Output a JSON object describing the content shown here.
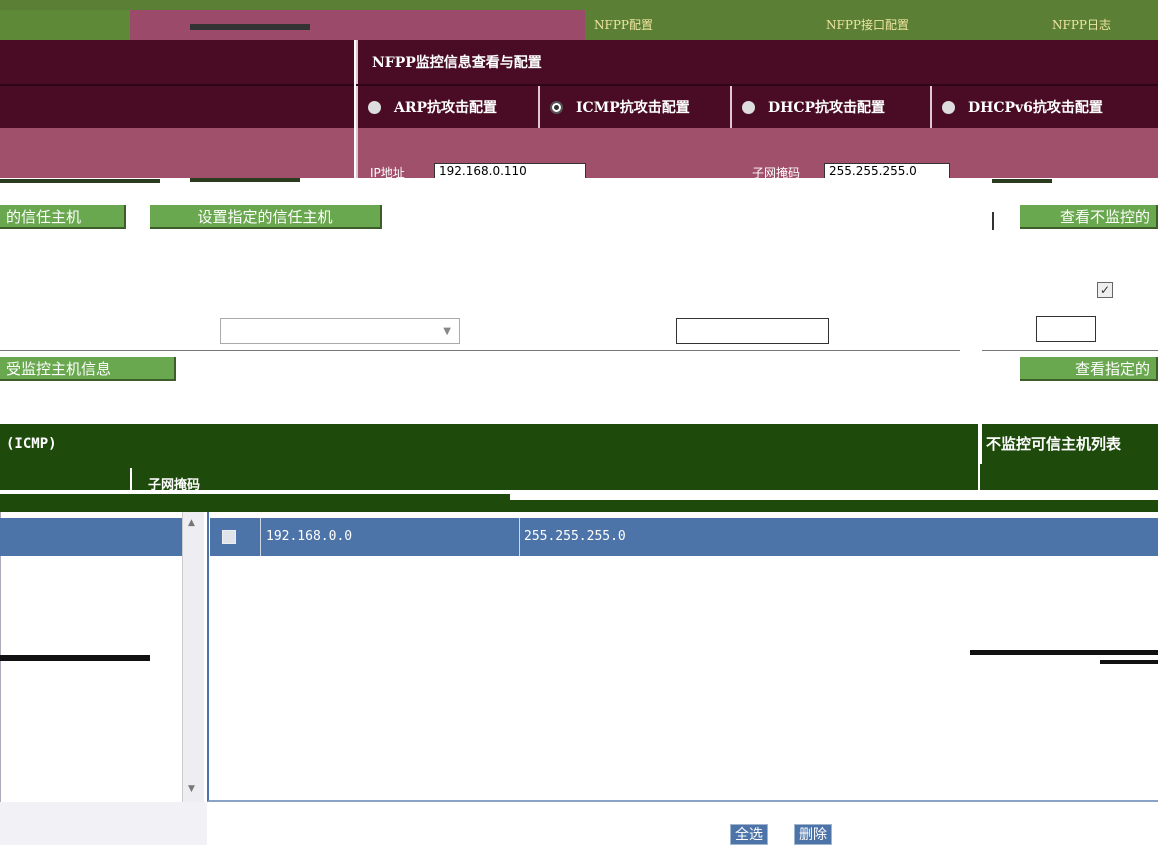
{
  "tabs": [
    {
      "label": "NFPP配置"
    },
    {
      "label": "NFPP接口配置"
    },
    {
      "label": "NFPP日志"
    }
  ],
  "panel": {
    "title": "NFPP监控信息查看与配置",
    "radios": [
      {
        "label": "ARP抗攻击配置",
        "selected": false
      },
      {
        "label": "ICMP抗攻击配置",
        "selected": true
      },
      {
        "label": "DHCP抗攻击配置",
        "selected": false
      },
      {
        "label": "DHCPv6抗攻击配置",
        "selected": false
      }
    ],
    "ip_label": "IP地址",
    "ip_value": "192.168.0.110",
    "mask_label": "子网掩码",
    "mask_value": "255.255.255.0"
  },
  "buttons": {
    "trusted_host": "的信任主机",
    "set_trusted_host": "设置指定的信任主机",
    "view_unmonitored": "查看不监控的",
    "monitored_info": "受监控主机信息",
    "view_specified": "查看指定的"
  },
  "icmp_section": {
    "title": "(ICMP)",
    "right_title": "不监控可信主机列表",
    "col_mask": "子网掩码"
  },
  "table": {
    "rows": [
      {
        "ip": "192.168.0.0",
        "mask": "255.255.255.0",
        "checked": false
      }
    ]
  },
  "footer": {
    "select_all": "全选",
    "delete": "删除"
  },
  "colors": {
    "tab_green": "#5a7f35",
    "maroon": "#4a0c24",
    "pink": "#a1506c",
    "button_green": "#6aa84f",
    "header_green": "#1e4a0c",
    "row_blue": "#4d74a8"
  }
}
